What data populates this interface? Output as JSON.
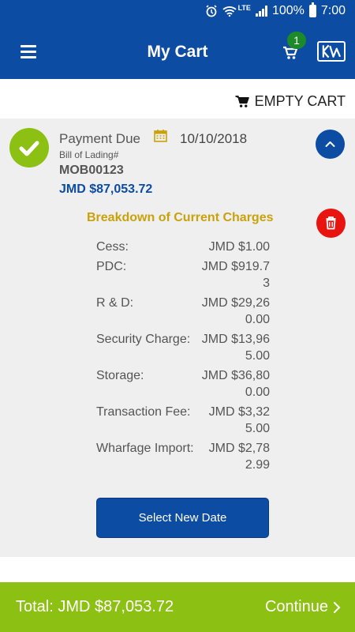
{
  "status_bar": {
    "battery": "100%",
    "time": "7:00",
    "network": "LTE"
  },
  "app_bar": {
    "title": "My Cart",
    "cart_count": "1"
  },
  "toolbar": {
    "empty_cart_label": "EMPTY CART"
  },
  "cart_item": {
    "status_label": "Payment Due",
    "due_date": "10/10/2018",
    "bol_label": "Bill of Lading#",
    "bol_number": "MOB00123",
    "amount": "JMD $87,053.72",
    "breakdown_title": "Breakdown of Current Charges",
    "charges": [
      {
        "label": "Cess:",
        "value": "JMD $1.00"
      },
      {
        "label": "PDC:",
        "value": "JMD $919.73"
      },
      {
        "label": "R & D:",
        "value": "JMD $29,260.00"
      },
      {
        "label": "Security Charge:",
        "value": "JMD $13,965.00"
      },
      {
        "label": "Storage:",
        "value": "JMD $36,800.00"
      },
      {
        "label": "Transaction Fee:",
        "value": "JMD $3,325.00"
      },
      {
        "label": "Wharfage Import:",
        "value": "JMD $2,782.99"
      }
    ],
    "select_date_label": "Select New Date"
  },
  "footer": {
    "total_label": "Total: JMD $87,053.72",
    "continue_label": "Continue"
  },
  "colors": {
    "primary": "#0c4ca3",
    "accent_green": "#8cc012",
    "badge_green": "#1d8a2a",
    "danger": "#e8140f",
    "breakdown_title": "#c9a20b"
  },
  "icons": [
    "alarm-icon",
    "wifi-icon",
    "signal-icon",
    "battery-icon",
    "menu-icon",
    "cart-icon",
    "logo-icon",
    "check-icon",
    "calendar-icon",
    "chevron-up-icon",
    "trash-icon",
    "chevron-right-icon"
  ]
}
